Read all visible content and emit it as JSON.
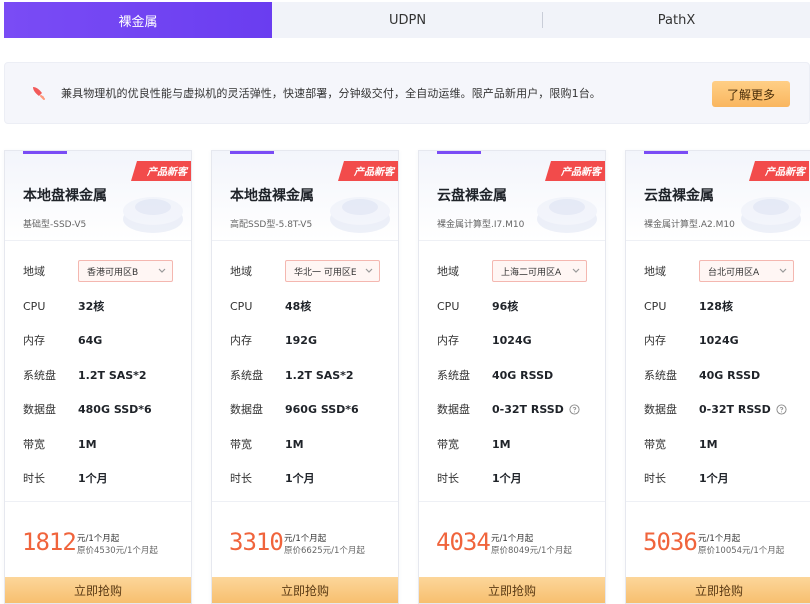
{
  "tabs": [
    {
      "label": "裸金属"
    },
    {
      "label": "UDPN"
    },
    {
      "label": "PathX"
    }
  ],
  "banner": {
    "text": "兼具物理机的优良性能与虚拟机的灵活弹性，快速部署，分钟级交付，全自动运维。限产品新用户，限购1台。",
    "button_label": "了解更多"
  },
  "spec_labels": {
    "region": "地域",
    "cpu": "CPU",
    "memory": "内存",
    "system_disk": "系统盘",
    "data_disk": "数据盘",
    "bandwidth": "带宽",
    "duration": "时长"
  },
  "cards": [
    {
      "tag": "产品新客",
      "title": "本地盘裸金属",
      "subtitle": "基础型-SSD-V5",
      "region": "香港可用区B",
      "cpu": "32核",
      "memory": "64G",
      "system_disk": "1.2T SAS*2",
      "data_disk": "480G SSD*6",
      "bandwidth": "1M",
      "duration": "1个月",
      "price": "1812",
      "price_unit": "元/1个月起",
      "original_price": "原价4530元/1个月起",
      "buy_label": "立即抢购"
    },
    {
      "tag": "产品新客",
      "title": "本地盘裸金属",
      "subtitle": "高配SSD型-5.8T-V5",
      "region": "华北一 可用区E",
      "cpu": "48核",
      "memory": "192G",
      "system_disk": "1.2T SAS*2",
      "data_disk": "960G SSD*6",
      "bandwidth": "1M",
      "duration": "1个月",
      "price": "3310",
      "price_unit": "元/1个月起",
      "original_price": "原价6625元/1个月起",
      "buy_label": "立即抢购"
    },
    {
      "tag": "产品新客",
      "title": "云盘裸金属",
      "subtitle": "裸金属计算型.I7.M10",
      "region": "上海二可用区A",
      "cpu": "96核",
      "memory": "1024G",
      "system_disk": "40G RSSD",
      "data_disk": "0-32T RSSD",
      "bandwidth": "1M",
      "duration": "1个月",
      "price": "4034",
      "price_unit": "元/1个月起",
      "original_price": "原价8049元/1个月起",
      "buy_label": "立即抢购"
    },
    {
      "tag": "产品新客",
      "title": "云盘裸金属",
      "subtitle": "裸金属计算型.A2.M10",
      "region": "台北可用区A",
      "cpu": "128核",
      "memory": "1024G",
      "system_disk": "40G RSSD",
      "data_disk": "0-32T RSSD",
      "bandwidth": "1M",
      "duration": "1个月",
      "price": "5036",
      "price_unit": "元/1个月起",
      "original_price": "原价10054元/1个月起",
      "buy_label": "立即抢购"
    }
  ],
  "colors": {
    "accent": "#7a4cf5",
    "price": "#f0643c",
    "tag": "#f24b4b",
    "button": "#f7bf6f"
  }
}
